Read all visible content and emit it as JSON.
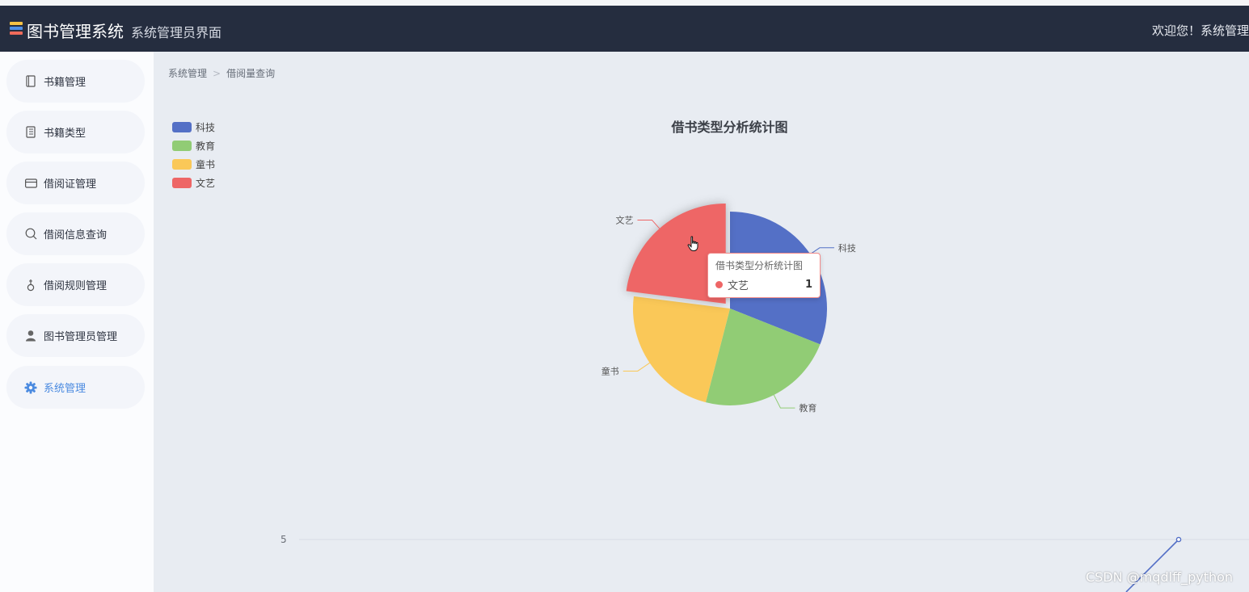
{
  "header": {
    "brand": "图书管理系统",
    "subtitle": "系统管理员界面",
    "welcome": "欢迎您！系统管理"
  },
  "sidebar": {
    "items": [
      {
        "label": "书籍管理",
        "icon": "book-icon"
      },
      {
        "label": "书籍类型",
        "icon": "document-icon"
      },
      {
        "label": "借阅证管理",
        "icon": "card-icon"
      },
      {
        "label": "借阅信息查询",
        "icon": "search-icon"
      },
      {
        "label": "借阅规则管理",
        "icon": "rule-icon"
      },
      {
        "label": "图书管理员管理",
        "icon": "user-icon"
      },
      {
        "label": "系统管理",
        "icon": "gear-icon",
        "active": true
      }
    ]
  },
  "breadcrumb": {
    "root": "系统管理",
    "current": "借阅量查询"
  },
  "colors": {
    "header_bg": "#252d3f",
    "accent": "#4a8ae0",
    "科技": "#5470c6",
    "教育": "#91cc75",
    "童书": "#fac858",
    "文艺": "#ee6666"
  },
  "chart_data": [
    {
      "type": "pie",
      "title": "借书类型分析统计图",
      "legend_position": "top-left",
      "categories": [
        "科技",
        "教育",
        "童书",
        "文艺"
      ],
      "values": [
        1.35,
        1,
        1,
        1
      ],
      "tooltip": {
        "title": "借书类型分析统计图",
        "name": "文艺",
        "value": "1"
      }
    },
    {
      "type": "line",
      "y_tick_labels": [
        "5"
      ],
      "visible_series": [
        {
          "x": [],
          "y": [
            5
          ]
        }
      ]
    }
  ]
}
